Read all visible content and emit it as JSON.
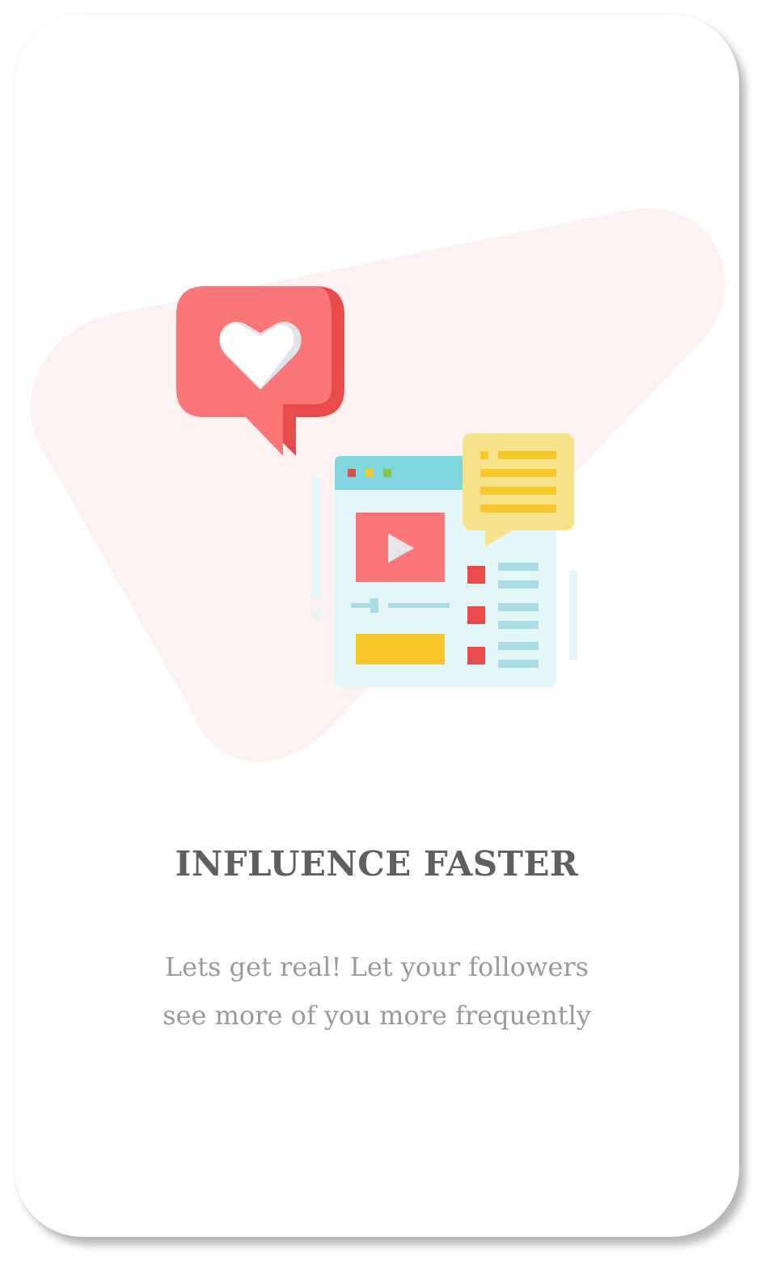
{
  "onboarding": {
    "title": "INFLUENCE FASTER",
    "description_lines": [
      "Lets get real! Let your followers",
      "see more of you more frequently"
    ]
  },
  "illustration": {
    "icons": [
      "heart-speech-bubble-icon",
      "video-browser-window-icon",
      "chat-bubble-icon",
      "play-icon"
    ],
    "colors": {
      "blob": "#fdf2f2",
      "heart_bubble": "#fb7676",
      "heart_bubble_shade": "#e84b4b",
      "browser_header": "#7fd8e0",
      "browser_body": "#e3f7f9",
      "chat_bubble": "#f6e38c",
      "chat_lines": "#f8c82a",
      "video": "#fb7676",
      "bar_yellow": "#f8c82a",
      "square_red": "#e84b4b",
      "line_blue": "#a8dce6"
    }
  }
}
